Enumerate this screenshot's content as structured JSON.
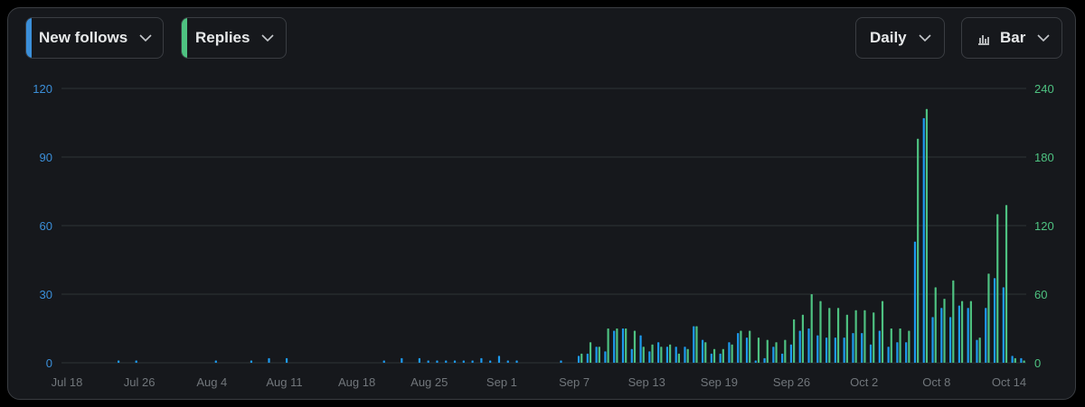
{
  "controls": {
    "metric_a": {
      "label": "New follows",
      "color": "#1d9bf0"
    },
    "metric_b": {
      "label": "Replies",
      "color": "#4ec281"
    },
    "interval": {
      "label": "Daily"
    },
    "chart_type": {
      "label": "Bar",
      "icon": "bar-chart-icon"
    }
  },
  "chart_data": {
    "type": "bar",
    "x_ticks": [
      "Jul 18",
      "Jul 26",
      "Aug 4",
      "Aug 11",
      "Aug 18",
      "Aug 25",
      "Sep 1",
      "Sep 7",
      "Sep 13",
      "Sep 19",
      "Sep 26",
      "Oct 2",
      "Oct 8",
      "Oct 14"
    ],
    "y_left": {
      "ticks": [
        "0",
        "30",
        "60",
        "90",
        "120"
      ],
      "ylim": [
        0,
        120
      ],
      "color": "#3b8fd9"
    },
    "y_right": {
      "ticks": [
        "0",
        "60",
        "120",
        "180",
        "240"
      ],
      "ylim": [
        0,
        240
      ],
      "color": "#4ec281"
    },
    "grid": true,
    "series": [
      {
        "name": "New follows",
        "axis": "left",
        "color": "#1d9bf0",
        "values": [
          0,
          0,
          0,
          0,
          0,
          0,
          1,
          0,
          1,
          0,
          0,
          0,
          0,
          0,
          0,
          0,
          0,
          1,
          0,
          0,
          0,
          1,
          0,
          2,
          0,
          2,
          0,
          0,
          0,
          0,
          0,
          0,
          0,
          0,
          0,
          0,
          1,
          0,
          2,
          0,
          2,
          1,
          1,
          1,
          1,
          1,
          1,
          2,
          1,
          3,
          1,
          1,
          0,
          0,
          0,
          0,
          1,
          0,
          3,
          4,
          7,
          5,
          14,
          15,
          6,
          12,
          5,
          9,
          7,
          7,
          7,
          16,
          10,
          4,
          4,
          9,
          13,
          11,
          1,
          2,
          7,
          4,
          8,
          14,
          15,
          12,
          11,
          11,
          11,
          13,
          13,
          8,
          14,
          7,
          9,
          9,
          53,
          107,
          20,
          24,
          20,
          25,
          24,
          10,
          24,
          37,
          33,
          3,
          2
        ]
      },
      {
        "name": "Replies",
        "axis": "right",
        "color": "#4ec281",
        "values": [
          0,
          0,
          0,
          0,
          0,
          0,
          0,
          0,
          0,
          0,
          0,
          0,
          0,
          0,
          0,
          0,
          0,
          0,
          0,
          0,
          0,
          0,
          0,
          0,
          0,
          0,
          0,
          0,
          0,
          0,
          0,
          0,
          0,
          0,
          0,
          0,
          0,
          0,
          0,
          0,
          0,
          0,
          0,
          0,
          0,
          0,
          0,
          0,
          0,
          0,
          0,
          0,
          0,
          0,
          0,
          0,
          0,
          0,
          8,
          18,
          14,
          30,
          30,
          30,
          28,
          14,
          16,
          14,
          16,
          8,
          12,
          32,
          18,
          12,
          12,
          16,
          28,
          28,
          22,
          20,
          18,
          20,
          38,
          42,
          60,
          54,
          48,
          48,
          42,
          46,
          46,
          44,
          54,
          30,
          30,
          28,
          196,
          222,
          66,
          56,
          72,
          54,
          54,
          22,
          78,
          130,
          138,
          4,
          2
        ]
      }
    ]
  }
}
